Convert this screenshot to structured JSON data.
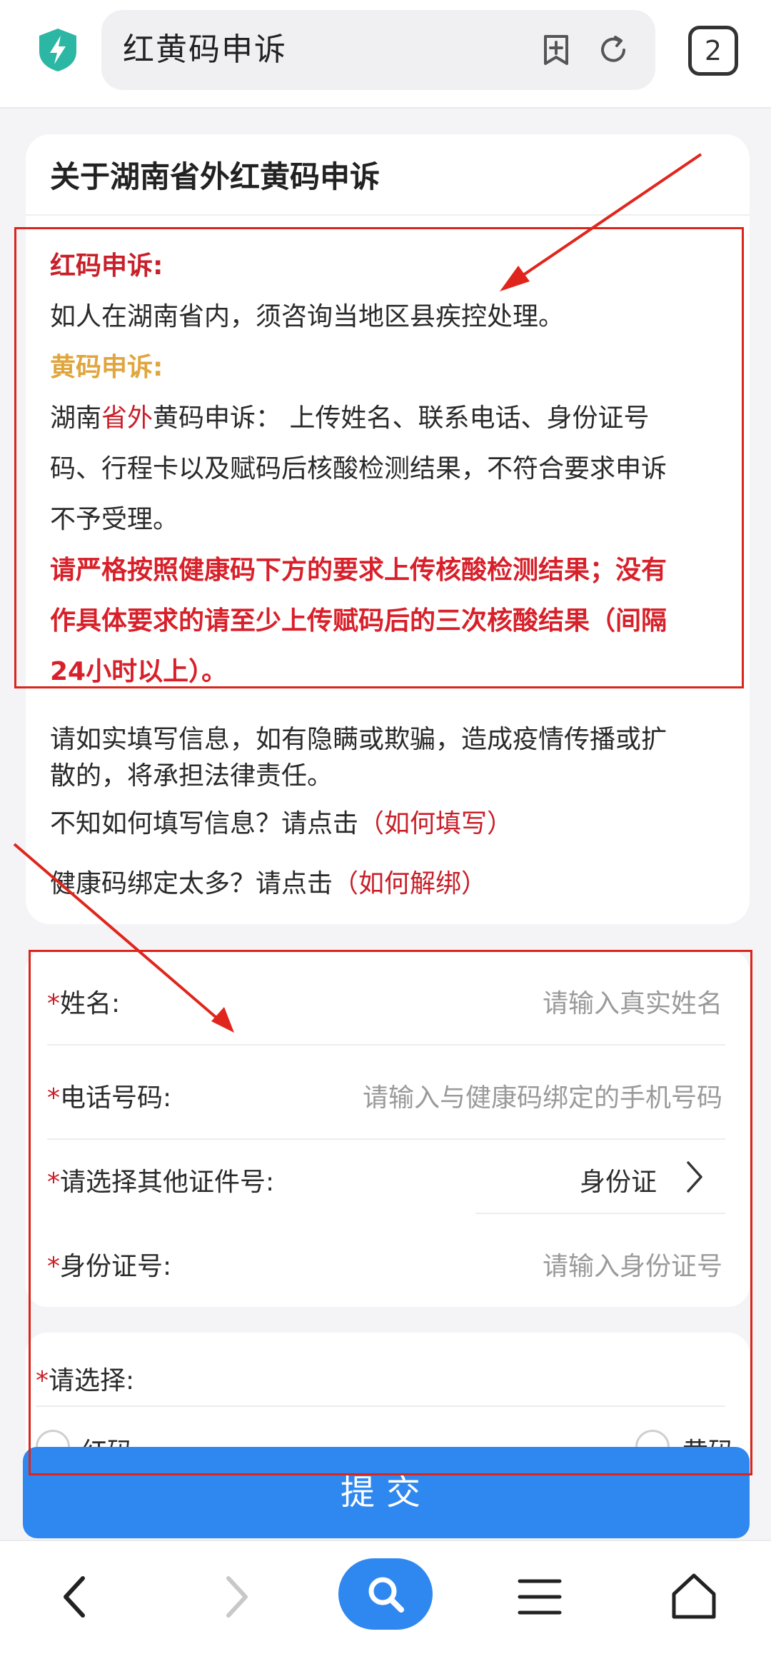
{
  "browser": {
    "address": "红黄码申诉",
    "tab_count": "2",
    "accent_color": "#2f88f0",
    "icons": [
      "shield-bolt-icon",
      "add-bookmark-icon",
      "refresh-icon"
    ]
  },
  "notice": {
    "title": "关于湖南省外红黄码申诉",
    "red_heading": "红码申诉:",
    "red_text": "如人在湖南省内，须咨询当地区县疾控处理。",
    "yellow_heading": "黄码申诉:",
    "yellow_line1_a": "湖南",
    "yellow_line1_b": "省外",
    "yellow_line1_c": "黄码申诉：  上传姓名、联系电话、身份证号",
    "yellow_line2": "码、行程卡以及赋码后核酸检测结果，不符合要求申诉",
    "yellow_line3": "不予受理。",
    "warn_line1": "请严格按照健康码下方的要求上传核酸检测结果；没有",
    "warn_line2": "作具体要求的请至少上传赋码后的三次核酸结果（间隔",
    "warn_line3": "24小时以上）。",
    "honest_line1": "请如实填写信息，如有隐瞒或欺骗，造成疫情传播或扩",
    "honest_line2": "散的，将承担法律责任。",
    "help_fill_prefix": "不知如何填写信息？请点击",
    "help_fill_link": "（如何填写）",
    "help_unbind_prefix": "健康码绑定太多？请点击",
    "help_unbind_link": "（如何解绑）"
  },
  "form": {
    "required_mark": "*",
    "name_label": "姓名:",
    "name_placeholder": "请输入真实姓名",
    "phone_label": "电话号码:",
    "phone_placeholder": "请输入与健康码绑定的手机号码",
    "idtype_label": "请选择其他证件号:",
    "idtype_value": "身份证",
    "idnum_label": "身份证号:",
    "idnum_placeholder": "请输入身份证号",
    "select_label": "请选择:",
    "option_red": "红码",
    "option_yellow": "黄码",
    "submit_label": "提交"
  },
  "bottom_nav": [
    "back-icon",
    "forward-icon",
    "search-icon",
    "menu-icon",
    "home-icon"
  ]
}
